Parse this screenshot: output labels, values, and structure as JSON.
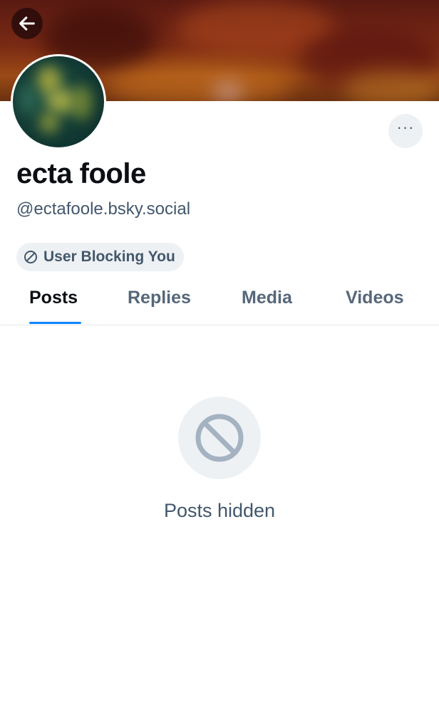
{
  "header": {
    "back_icon": "arrow-left-icon",
    "banner_colors": [
      "#5a1a12",
      "#7a2a14",
      "#9a4a16"
    ]
  },
  "profile": {
    "display_name": "ecta foole",
    "handle": "@ectafoole.bsky.social",
    "more_icon": "more-horizontal-icon",
    "more_label": "···",
    "block_status": {
      "icon": "block-icon",
      "label": "User Blocking You"
    }
  },
  "tabs": {
    "items": [
      {
        "label": "Posts",
        "active": true
      },
      {
        "label": "Replies",
        "active": false
      },
      {
        "label": "Media",
        "active": false
      },
      {
        "label": "Videos",
        "active": false
      }
    ],
    "accent_color": "#1083fe"
  },
  "feed": {
    "empty_icon": "block-icon",
    "empty_message": "Posts hidden"
  }
}
